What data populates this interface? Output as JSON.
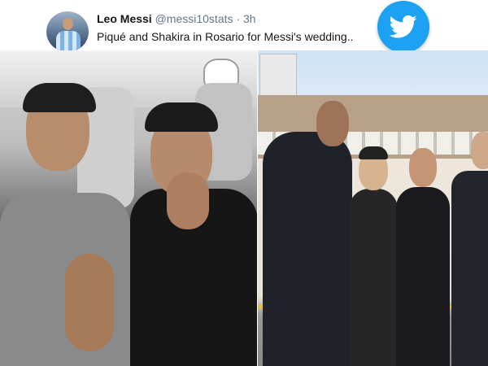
{
  "tweet": {
    "author_name": "Leo Messi",
    "author_handle": "@messi10stats",
    "separator": "·",
    "time": "3h",
    "text": "Piqué and Shakira in Rosario for Messi's wedding.."
  },
  "icons": {
    "avatar": "avatar",
    "brand": "twitter-bird-icon"
  },
  "colors": {
    "brand": "#1da1f2",
    "name": "#14171a",
    "secondary": "#657786"
  }
}
